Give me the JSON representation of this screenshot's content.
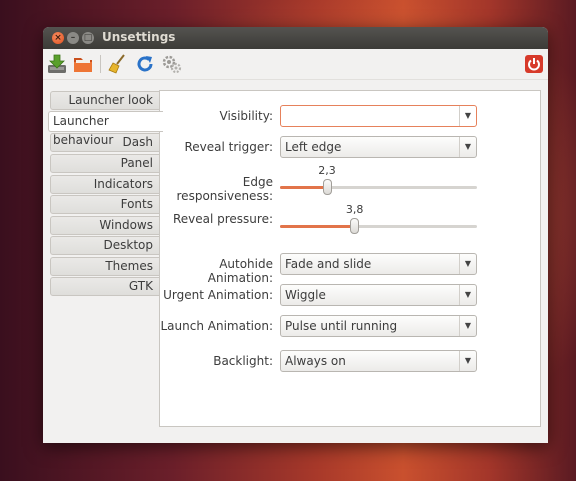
{
  "window": {
    "title": "Unsettings"
  },
  "titlebar_buttons": {
    "close": "×",
    "minimize": "–",
    "maximize": "□"
  },
  "toolbar": {
    "icons": [
      "download-icon",
      "folder-icon",
      "broom-icon",
      "reload-icon",
      "gears-icon",
      "power-icon"
    ],
    "colors": {
      "power": "#d73a2a",
      "reload": "#2a72c8",
      "folder": "#e8692c"
    }
  },
  "tabs": [
    {
      "label": "Launcher look"
    },
    {
      "label": "Launcher behaviour",
      "active": true
    },
    {
      "label": "Dash"
    },
    {
      "label": "Panel"
    },
    {
      "label": "Indicators"
    },
    {
      "label": "Fonts"
    },
    {
      "label": "Windows"
    },
    {
      "label": "Desktop"
    },
    {
      "label": "Themes"
    },
    {
      "label": "GTK"
    }
  ],
  "settings": {
    "visibility": {
      "label": "Visibility:",
      "value": ""
    },
    "reveal_trigger": {
      "label": "Reveal trigger:",
      "value": "Left edge"
    },
    "edge_responsiveness": {
      "label": "Edge responsiveness:",
      "value_text": "2,3",
      "fraction": 0.24
    },
    "reveal_pressure": {
      "label": "Reveal pressure:",
      "value_text": "3,8",
      "fraction": 0.38
    },
    "autohide_animation": {
      "label": "Autohide Animation:",
      "value": "Fade and slide"
    },
    "urgent_animation": {
      "label": "Urgent Animation:",
      "value": "Wiggle"
    },
    "launch_animation": {
      "label": "Launch Animation:",
      "value": "Pulse until running"
    },
    "backlight": {
      "label": "Backlight:",
      "value": "Always on"
    }
  },
  "accent_color": "#e2744a"
}
